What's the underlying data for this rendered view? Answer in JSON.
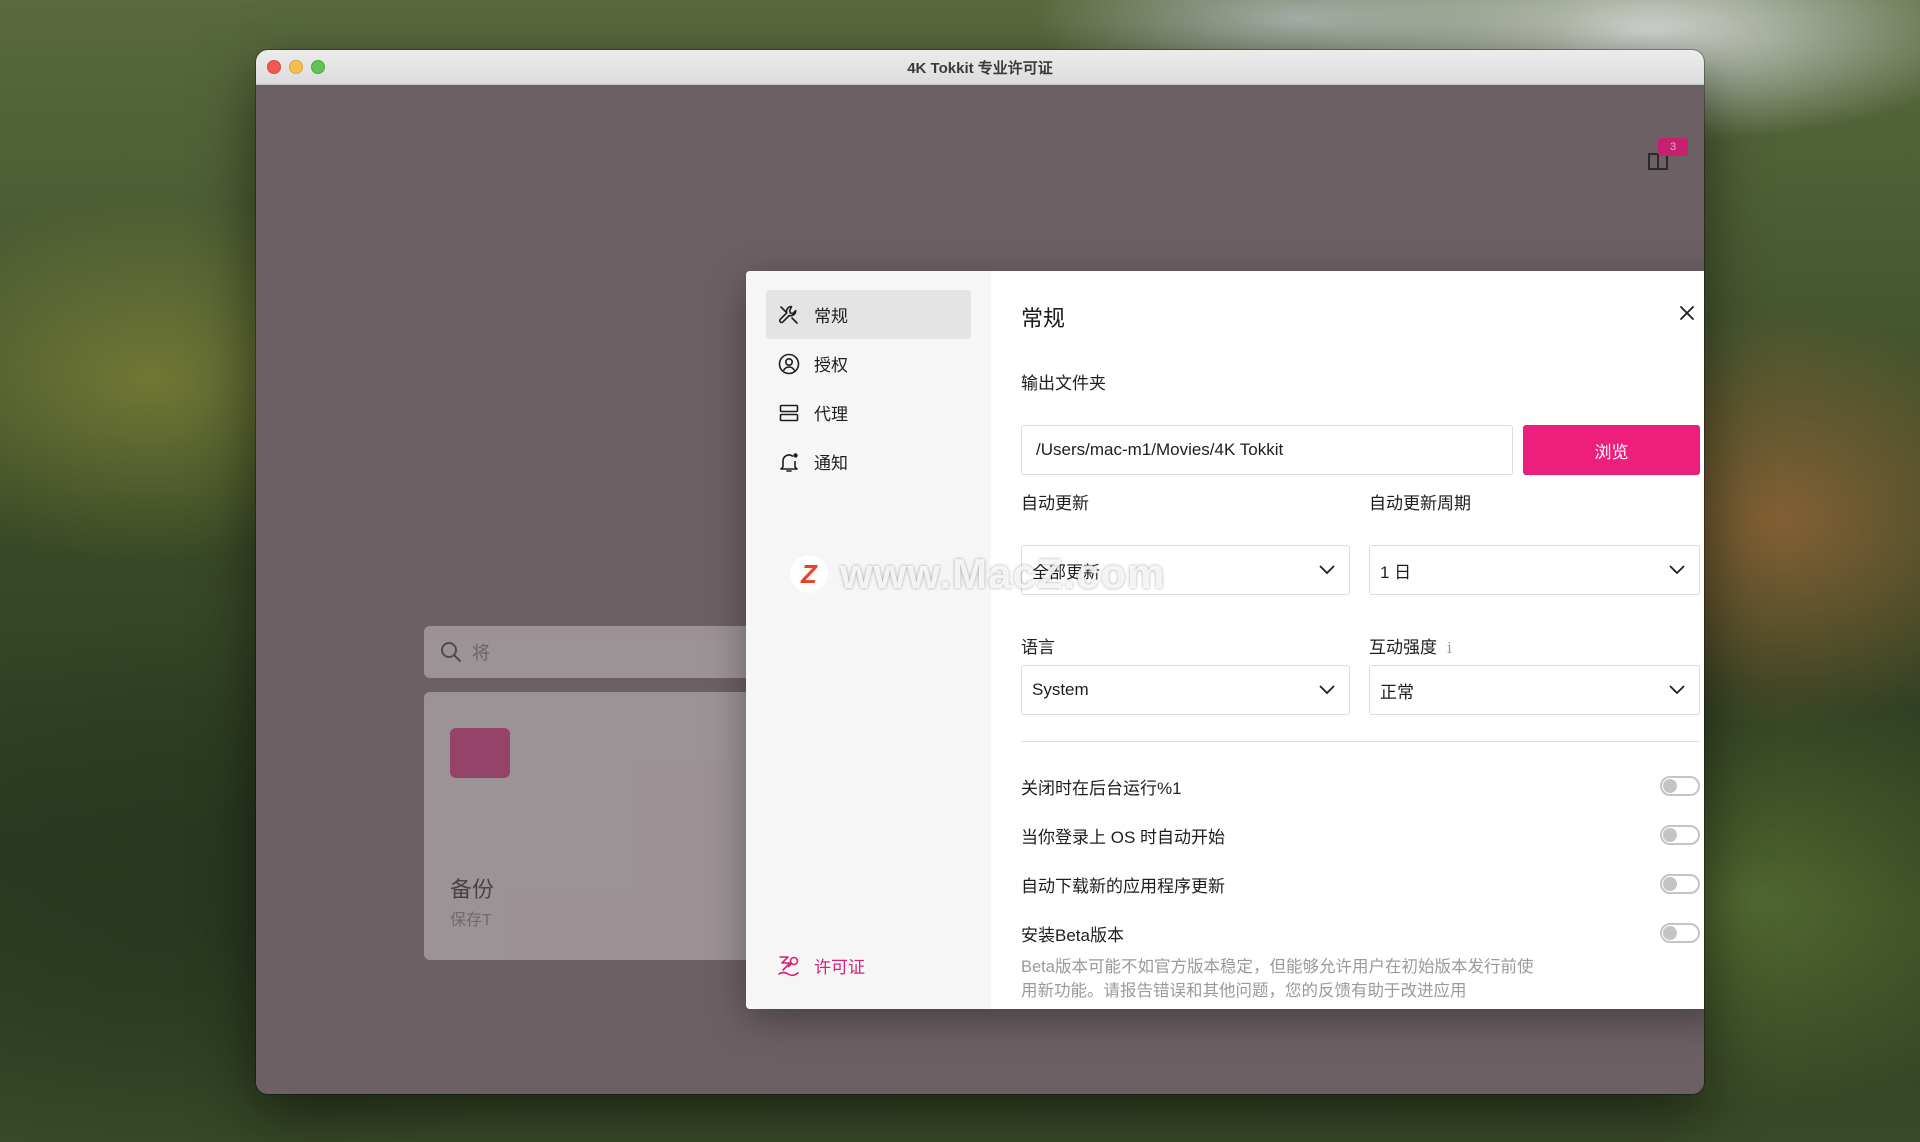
{
  "window": {
    "title": "4K Tokkit 专业许可证"
  },
  "background": {
    "search_placeholder": "将",
    "backup_title": "备份",
    "backup_subtitle": "保存T",
    "notification_count": "3"
  },
  "dialog": {
    "title": "常规",
    "sidebar": {
      "items": [
        {
          "label": "常规",
          "icon": "wrench-icon",
          "active": true
        },
        {
          "label": "授权",
          "icon": "user-circle-icon",
          "active": false
        },
        {
          "label": "代理",
          "icon": "server-icon",
          "active": false
        },
        {
          "label": "通知",
          "icon": "bell-icon",
          "active": false
        }
      ],
      "license_label": "许可证"
    },
    "output_folder": {
      "label": "输出文件夹",
      "value": "/Users/mac-m1/Movies/4K Tokkit",
      "browse_label": "浏览"
    },
    "auto_update": {
      "label": "自动更新",
      "value": "全部更新"
    },
    "auto_update_period": {
      "label": "自动更新周期",
      "value": "1 日"
    },
    "language": {
      "label": "语言",
      "value": "System"
    },
    "interaction_intensity": {
      "label": "互动强度",
      "info": "i",
      "value": "正常"
    },
    "toggles": [
      {
        "label": "关闭时在后台运行%1",
        "on": false
      },
      {
        "label": "当你登录上 OS 时自动开始",
        "on": false
      },
      {
        "label": "自动下载新的应用程序更新",
        "on": false
      },
      {
        "label": "安装Beta版本",
        "on": false
      }
    ],
    "beta_description": "Beta版本可能不如官方版本稳定，但能够允许用户在初始版本发行前使用新功能。请报告错误和其他问题，您的反馈有助于改进应用"
  },
  "watermark": {
    "logo": "Z",
    "text": "www.MacZ.com"
  },
  "colors": {
    "accent": "#ee1f7c",
    "license_text": "#d8217a"
  }
}
